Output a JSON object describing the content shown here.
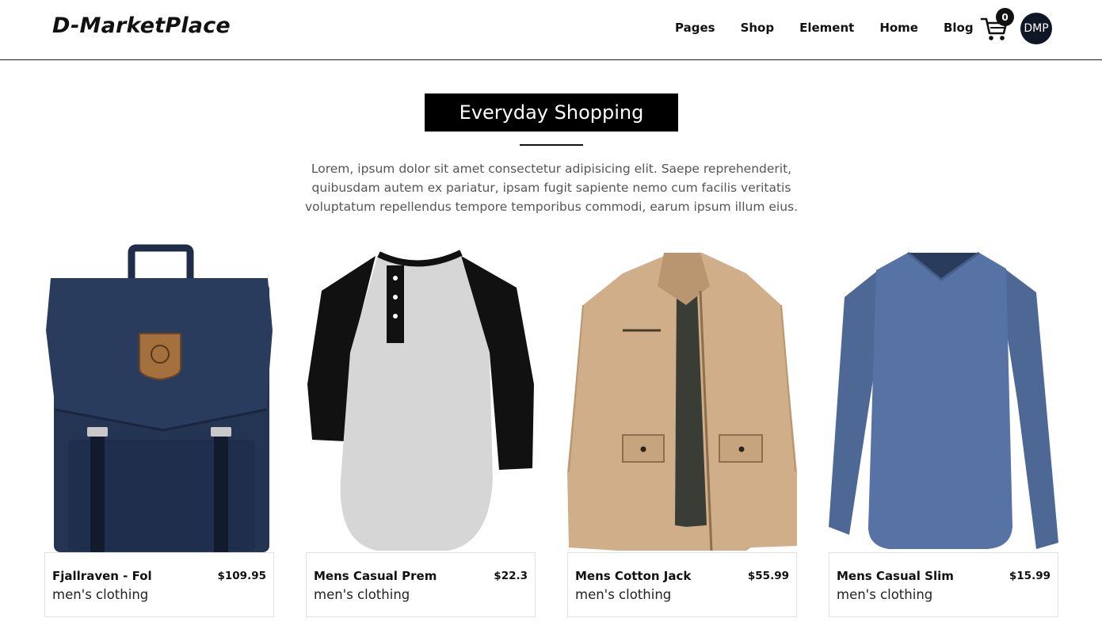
{
  "brand": "D-MarketPlace",
  "nav": {
    "links": [
      "Pages",
      "Shop",
      "Element",
      "Home",
      "Blog"
    ],
    "cart_count": "0",
    "avatar_initials": "DMP"
  },
  "section": {
    "title": "Everyday Shopping",
    "description": "Lorem, ipsum dolor sit amet consectetur adipisicing elit. Saepe reprehenderit, quibusdam autem ex pariatur, ipsam fugit sapiente nemo cum facilis veritatis voluptatum repellendus tempore temporibus commodi, earum ipsum illum eius."
  },
  "products": [
    {
      "name": "Fjallraven - Fol",
      "price": "$109.95",
      "category": "men's clothing",
      "image": "backpack"
    },
    {
      "name": "Mens Casual Prem",
      "price": "$22.3",
      "category": "men's clothing",
      "image": "raglan-henley"
    },
    {
      "name": "Mens Cotton Jack",
      "price": "$55.99",
      "category": "men's clothing",
      "image": "cotton-jacket"
    },
    {
      "name": "Mens Casual Slim",
      "price": "$15.99",
      "category": "men's clothing",
      "image": "long-sleeve-tee"
    }
  ]
}
